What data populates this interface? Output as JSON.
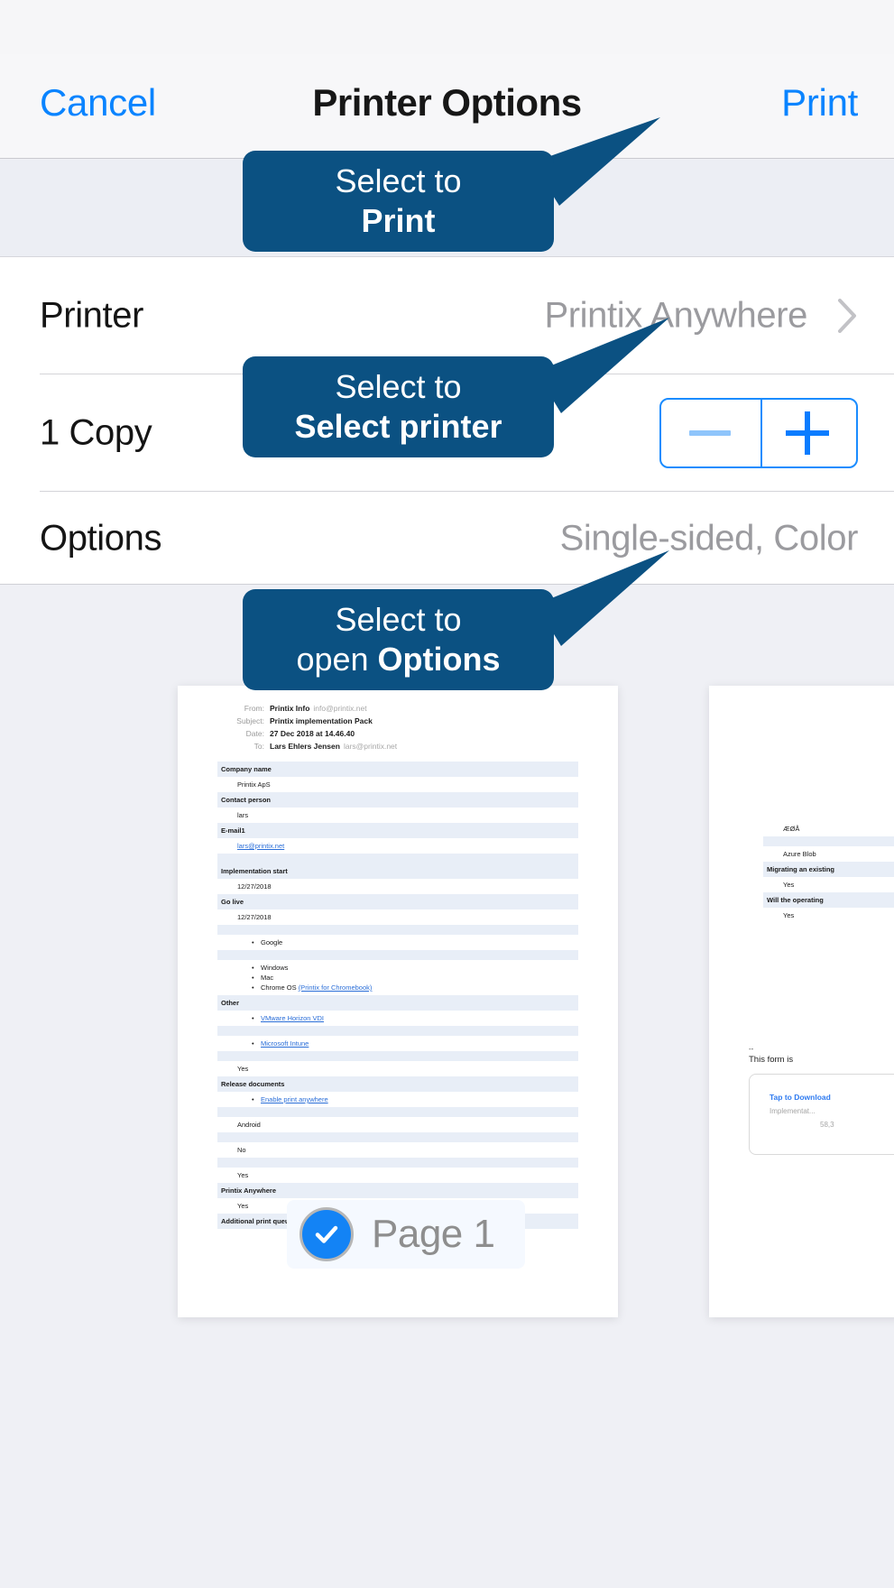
{
  "navbar": {
    "cancel_label": "Cancel",
    "title": "Printer Options",
    "print_label": "Print"
  },
  "settings": {
    "rows": [
      {
        "label": "Printer",
        "value": "Printix Anywhere",
        "accessory": "chevron-right-icon"
      },
      {
        "label": "1 Copy",
        "value": "",
        "accessory": "stepper"
      },
      {
        "label": "Options",
        "value": "Single-sided, Color",
        "accessory": "none"
      }
    ]
  },
  "callouts": [
    {
      "line1": "Select to",
      "line2": "Print",
      "target": "print-button"
    },
    {
      "line1": "Select to",
      "line2": "Select printer",
      "target": "printer-row"
    },
    {
      "line1": "Select to",
      "line2_prefix": "open ",
      "line2_bold": "Options",
      "target": "options-row"
    }
  ],
  "preview": {
    "page_badge": {
      "label": "Page 1",
      "icon": "check-circle-icon"
    },
    "document": {
      "mail_header": [
        {
          "label": "From:",
          "strong": "Printix Info",
          "dim": "info@printix.net"
        },
        {
          "label": "Subject:",
          "strong": "Printix implementation Pack",
          "dim": ""
        },
        {
          "label": "Date:",
          "strong": "27 Dec 2018 at 14.46.40",
          "dim": ""
        },
        {
          "label": "To:",
          "strong": "Lars Ehlers Jensen",
          "dim": "lars@printix.net"
        }
      ],
      "rows": [
        {
          "type": "hdr",
          "text": "Company name"
        },
        {
          "type": "val",
          "text": "Printix ApS"
        },
        {
          "type": "hdr",
          "text": "Contact person"
        },
        {
          "type": "val",
          "text": "lars"
        },
        {
          "type": "hdr",
          "text": "E-mail1"
        },
        {
          "type": "link",
          "text": "lars@printix.net"
        },
        {
          "type": "blank",
          "text": ""
        },
        {
          "type": "hdr",
          "text": "Implementation start"
        },
        {
          "type": "val",
          "text": "12/27/2018"
        },
        {
          "type": "hdr",
          "text": "Go live"
        },
        {
          "type": "val",
          "text": "12/27/2018"
        },
        {
          "type": "blank",
          "text": ""
        },
        {
          "type": "bullets",
          "items": [
            "Google"
          ]
        },
        {
          "type": "blank",
          "text": ""
        },
        {
          "type": "bullets",
          "items": [
            "Windows",
            "Mac",
            "Chrome OS (Printix for Chromebook)"
          ]
        },
        {
          "type": "hdr",
          "text": "Other"
        },
        {
          "type": "bullets-link",
          "items": [
            "VMware Horizon VDI"
          ]
        },
        {
          "type": "blank",
          "text": ""
        },
        {
          "type": "bullets-link",
          "items": [
            "Microsoft Intune"
          ]
        },
        {
          "type": "blank",
          "text": ""
        },
        {
          "type": "val",
          "text": "Yes"
        },
        {
          "type": "hdr",
          "text": "Release documents"
        },
        {
          "type": "bullets-link",
          "items": [
            "Enable print anywhere"
          ]
        },
        {
          "type": "blank",
          "text": ""
        },
        {
          "type": "val",
          "text": "Android"
        },
        {
          "type": "blank",
          "text": ""
        },
        {
          "type": "val",
          "text": "No"
        },
        {
          "type": "blank",
          "text": ""
        },
        {
          "type": "val",
          "text": "Yes"
        },
        {
          "type": "hdr",
          "text": "Printix Anywhere"
        },
        {
          "type": "val",
          "text": "Yes"
        },
        {
          "type": "hdr",
          "text": "Additional print queues. Enter Name of print queue(s)"
        }
      ]
    },
    "document_right": {
      "rows": [
        {
          "type": "val",
          "text": "ÆØÅ"
        },
        {
          "type": "blank",
          "text": ""
        },
        {
          "type": "val",
          "text": "Azure Blob"
        },
        {
          "type": "hdr",
          "text": "Migrating an existing"
        },
        {
          "type": "val",
          "text": "Yes"
        },
        {
          "type": "hdr",
          "text": "Will the operating"
        },
        {
          "type": "val",
          "text": "Yes"
        }
      ],
      "footer": {
        "dash": "--",
        "text": "This form is",
        "card_link": "Tap to Download",
        "card_sub": "Implementat...",
        "card_size": "58,3"
      }
    }
  },
  "colors": {
    "accent_blue": "#0a84ff",
    "callout_blue": "#0b5182",
    "stepper_border": "#1a8cff",
    "background": "#eff0f5",
    "value_gray": "#9b9b9f"
  }
}
